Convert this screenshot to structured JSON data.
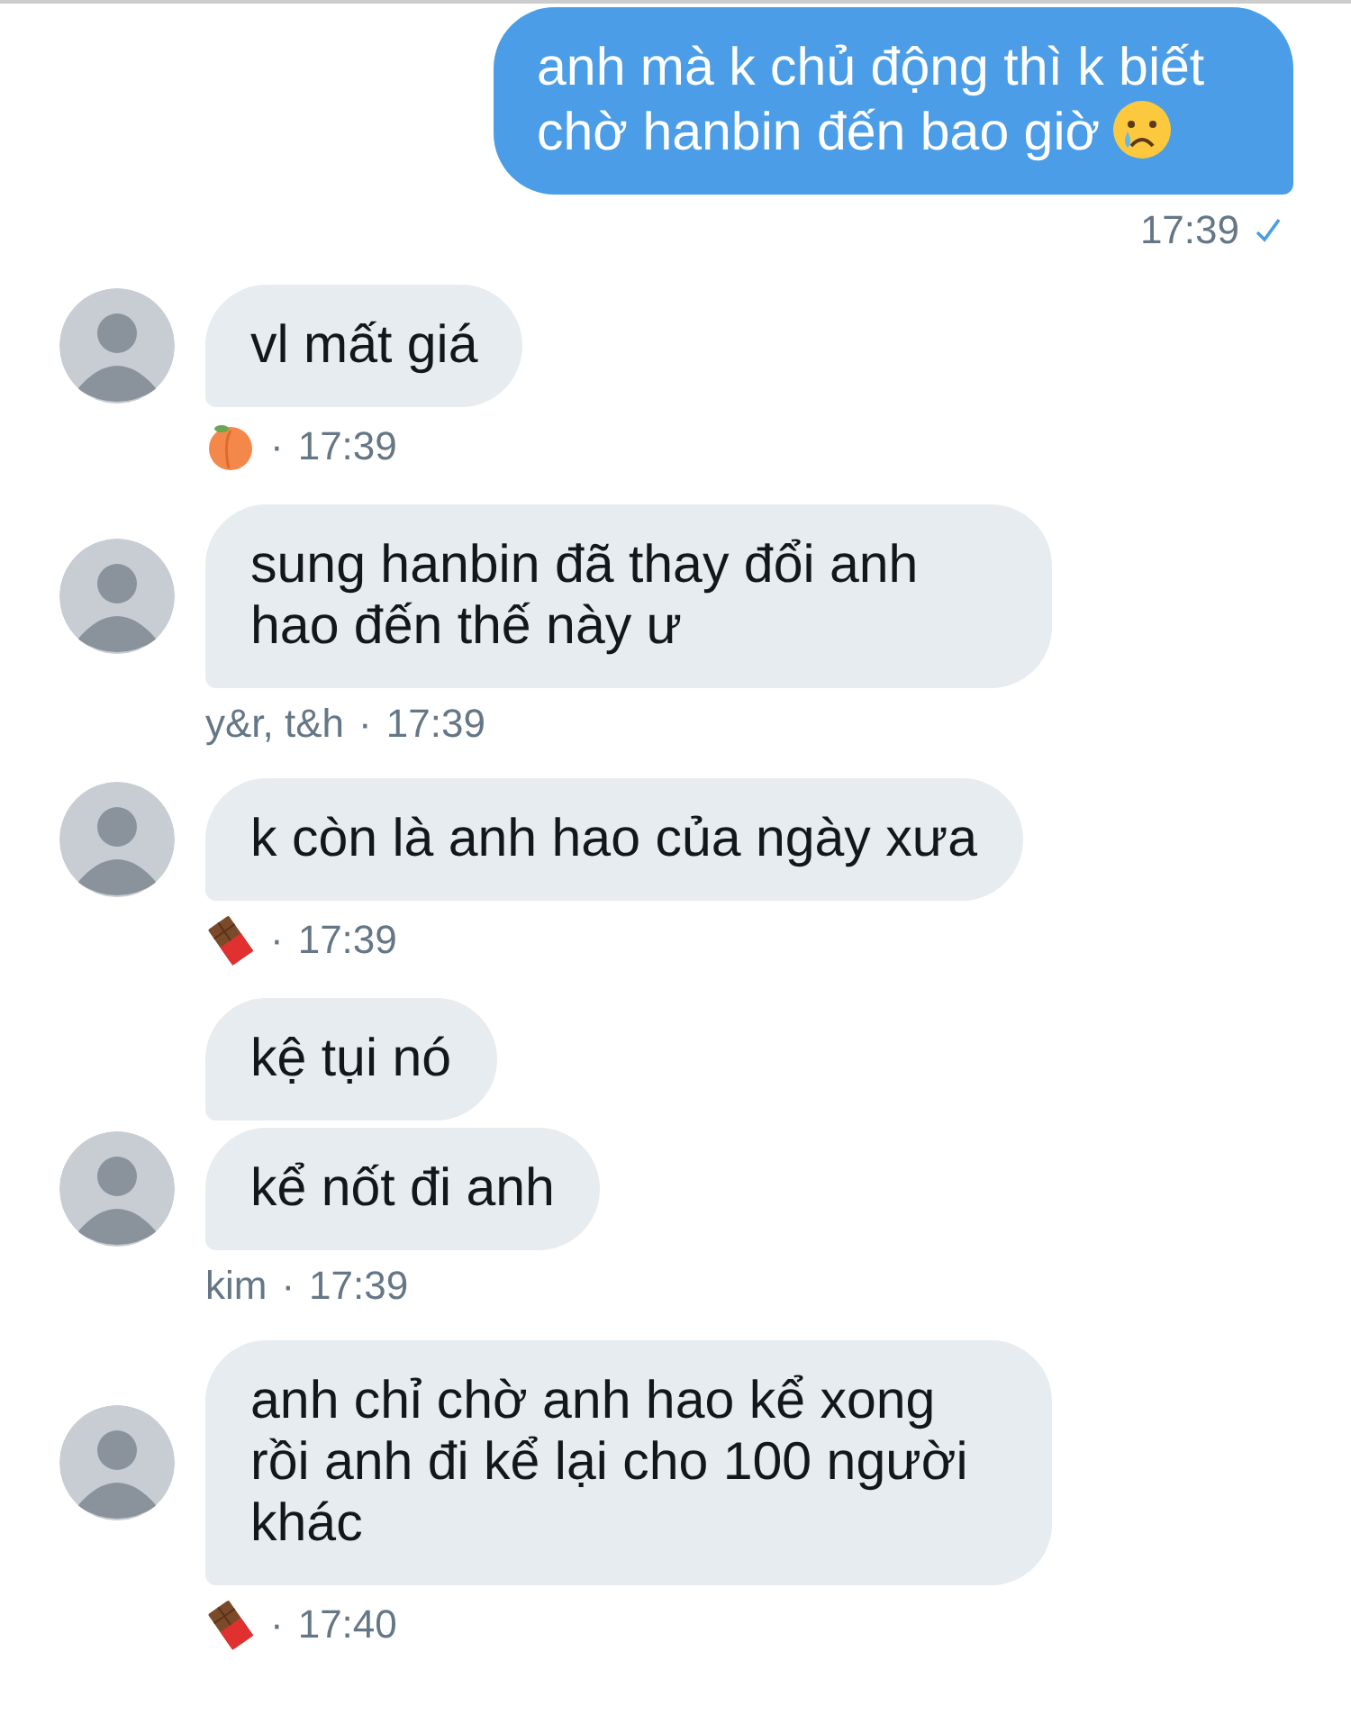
{
  "messages": [
    {
      "kind": "outgoing",
      "bubbles": [
        {
          "kind": "text-with-emoji",
          "text": "anh mà k chủ động thì k biết chờ hanbin đến bao giờ"
        }
      ],
      "time": "17:39",
      "read": true
    },
    {
      "kind": "incoming",
      "sender": {
        "kind": "peach"
      },
      "bubbles": [
        {
          "kind": "text",
          "text": "vl mất giá"
        }
      ],
      "separator": "·",
      "time": "17:39"
    },
    {
      "kind": "incoming",
      "sender": {
        "kind": "name",
        "name": "y&r, t&h"
      },
      "bubbles": [
        {
          "kind": "text",
          "text": "sung hanbin đã thay đổi anh hao đến thế này ư"
        }
      ],
      "separator": "·",
      "time": "17:39"
    },
    {
      "kind": "incoming",
      "sender": {
        "kind": "chocolate"
      },
      "bubbles": [
        {
          "kind": "text",
          "text": "k còn là anh hao của ngày xưa"
        }
      ],
      "separator": "·",
      "time": "17:39"
    },
    {
      "kind": "incoming",
      "sender": {
        "kind": "name",
        "name": "kim"
      },
      "bubbles": [
        {
          "kind": "text",
          "text": "kệ tụi nó"
        },
        {
          "kind": "text",
          "text": "kể nốt đi anh"
        }
      ],
      "separator": "·",
      "time": "17:39"
    },
    {
      "kind": "incoming",
      "sender": {
        "kind": "chocolate"
      },
      "bubbles": [
        {
          "kind": "text",
          "text": "anh chỉ chờ anh hao kể xong rồi anh đi kể lại cho 100 người khác"
        }
      ],
      "separator": "·",
      "time": "17:40"
    }
  ]
}
